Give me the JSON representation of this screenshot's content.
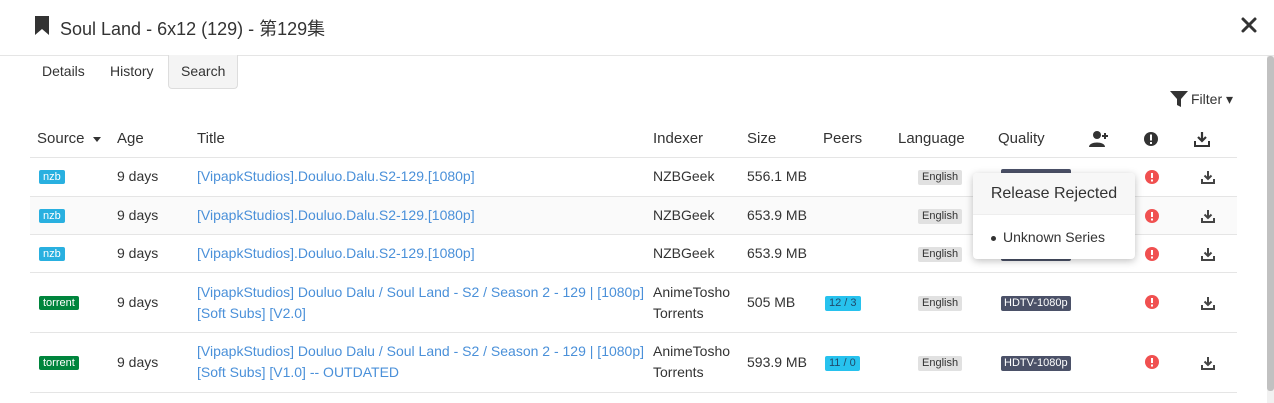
{
  "modal": {
    "title": "Soul Land - 6x12 (129) - 第129集",
    "bookmark_icon": "bookmark-icon",
    "close_icon": "close-icon"
  },
  "tabs": [
    {
      "label": "Details",
      "active": false
    },
    {
      "label": "History",
      "active": false
    },
    {
      "label": "Search",
      "active": true
    }
  ],
  "filter": {
    "label": "Filter ▾",
    "icon": "filter-icon"
  },
  "table": {
    "columns": [
      "Source",
      "Age",
      "Title",
      "Indexer",
      "Size",
      "Peers",
      "Language",
      "Quality"
    ],
    "icon_columns": [
      "add-user-icon",
      "exclamation-circle-icon",
      "download-icon"
    ],
    "rows": [
      {
        "source": "nzb",
        "age": "9 days",
        "title_lines": [
          "[VipapkStudios].Douluo.Dalu.S2-129.[1080p]"
        ],
        "indexer_lines": [
          "NZBGeek"
        ],
        "size": "556.1 MB",
        "peers": "",
        "language": "English",
        "quality": "",
        "rejected": true
      },
      {
        "source": "nzb",
        "age": "9 days",
        "title_lines": [
          "[VipapkStudios].Douluo.Dalu.S2-129.[1080p]"
        ],
        "indexer_lines": [
          "NZBGeek"
        ],
        "size": "653.9 MB",
        "peers": "",
        "language": "English",
        "quality": "",
        "rejected": true
      },
      {
        "source": "nzb",
        "age": "9 days",
        "title_lines": [
          "[VipapkStudios].Douluo.Dalu.S2-129.[1080p]"
        ],
        "indexer_lines": [
          "NZBGeek"
        ],
        "size": "653.9 MB",
        "peers": "",
        "language": "English",
        "quality": "",
        "rejected": true
      },
      {
        "source": "torrent",
        "age": "9 days",
        "title_lines": [
          "[VipapkStudios] Douluo Dalu / Soul Land - S2 / Season 2 - 129 | [1080p]",
          "[Soft Subs] [V2.0]"
        ],
        "indexer_lines": [
          "AnimeTosho",
          "Torrents"
        ],
        "size": "505 MB",
        "peers": "12 / 3",
        "language": "English",
        "quality": "HDTV-1080p",
        "rejected": true
      },
      {
        "source": "torrent",
        "age": "9 days",
        "title_lines": [
          "[VipapkStudios] Douluo Dalu / Soul Land - S2 / Season 2 - 129 | [1080p]",
          "[Soft Subs] [V1.0] -- OUTDATED"
        ],
        "indexer_lines": [
          "AnimeTosho",
          "Torrents"
        ],
        "size": "593.9 MB",
        "peers": "11 / 0",
        "language": "English",
        "quality": "HDTV-1080p",
        "rejected": true
      }
    ]
  },
  "popover": {
    "title": "Release Rejected",
    "items": [
      "Unknown Series"
    ]
  },
  "colors": {
    "nzb": "#29b0e0",
    "torrent": "#00853d",
    "link": "#4a90d9",
    "reject": "#f05050",
    "quality": "#4b5168",
    "peers": "#27c2ee"
  }
}
